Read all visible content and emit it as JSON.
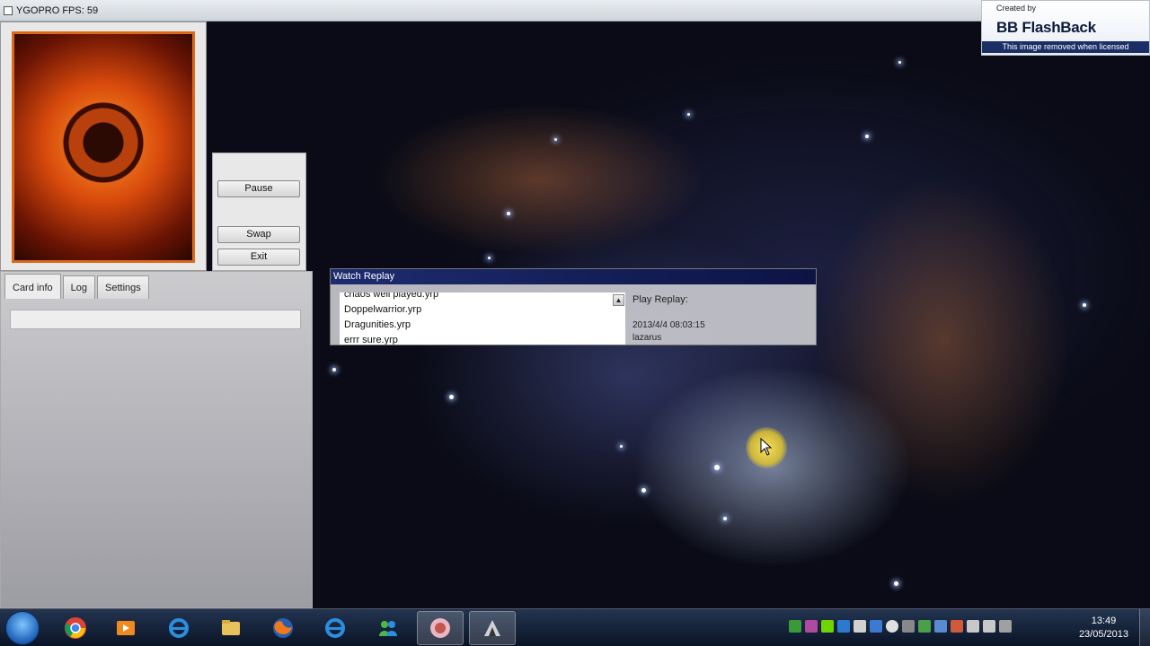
{
  "window": {
    "title": "YGOPRO FPS: 59"
  },
  "watermark": {
    "created_by": "Created by",
    "brand": "BB FlashBack",
    "notice": "This image removed when licensed"
  },
  "controls": {
    "pause": "Pause",
    "swap": "Swap",
    "exit": "Exit"
  },
  "info_panel": {
    "tabs": [
      "Card info",
      "Log",
      "Settings"
    ],
    "active_tab": "Card info"
  },
  "replay": {
    "title": "Watch Replay",
    "files": [
      "chaos well played.yrp",
      "Doppelwarrior.yrp",
      "Dragunities.yrp",
      "errr sure.yrp"
    ],
    "play_label": "Play Replay:",
    "date": "2013/4/4 08:03:15",
    "player": "lazarus"
  },
  "taskbar": {
    "pinned": [
      "start-orb",
      "chrome-icon",
      "media-player-icon",
      "internet-explorer-icon",
      "file-explorer-icon",
      "firefox-icon",
      "internet-explorer-icon",
      "messenger-icon",
      "ygopro-icon",
      "game-icon"
    ],
    "time": "13:49",
    "date": "23/05/2013"
  }
}
